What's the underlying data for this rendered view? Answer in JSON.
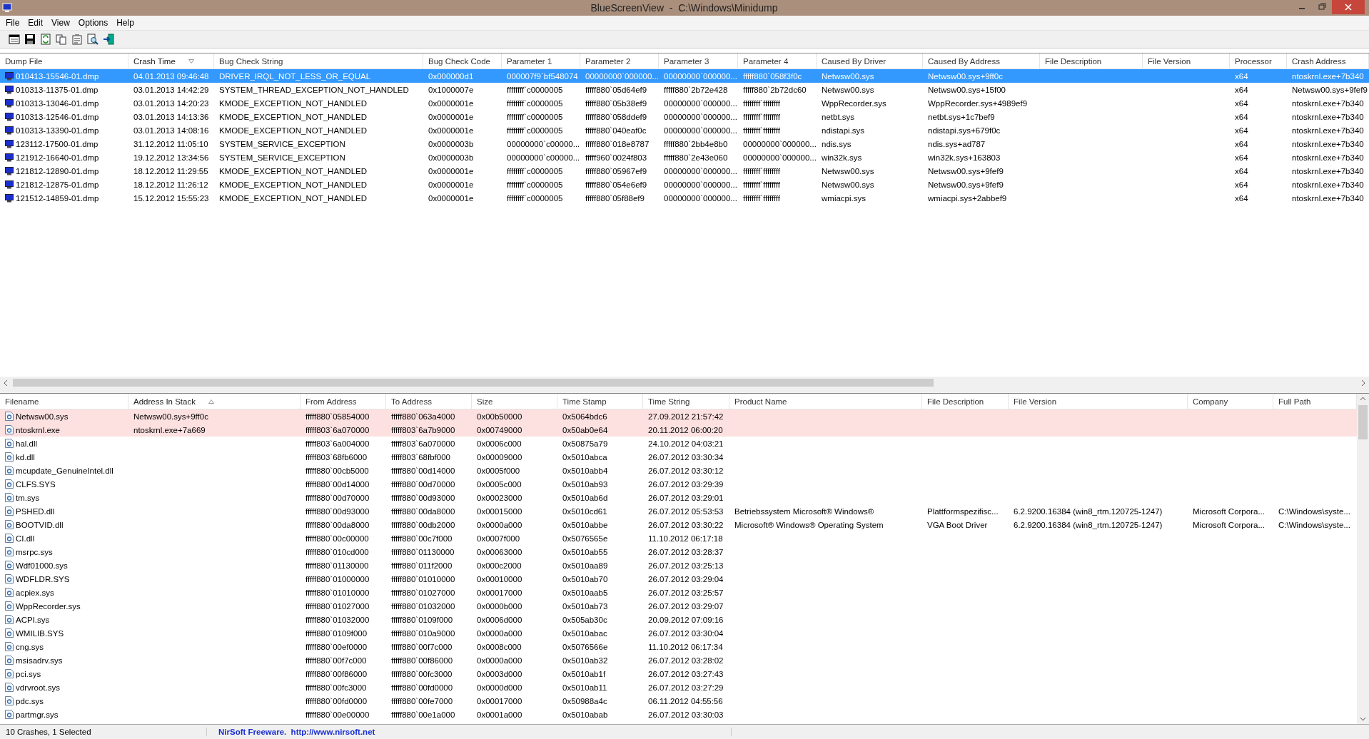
{
  "window": {
    "title": "BlueScreenView  -  C:\\Windows\\Minidump"
  },
  "menu": [
    "File",
    "Edit",
    "View",
    "Options",
    "Help"
  ],
  "crashes": {
    "columns": [
      {
        "label": "Dump File",
        "sorted": false
      },
      {
        "label": "Crash Time",
        "sorted": true,
        "descending": true
      },
      {
        "label": "Bug Check String",
        "sorted": false
      },
      {
        "label": "Bug Check Code",
        "sorted": false
      },
      {
        "label": "Parameter 1",
        "sorted": false
      },
      {
        "label": "Parameter 2",
        "sorted": false
      },
      {
        "label": "Parameter 3",
        "sorted": false
      },
      {
        "label": "Parameter 4",
        "sorted": false
      },
      {
        "label": "Caused By Driver",
        "sorted": false
      },
      {
        "label": "Caused By Address",
        "sorted": false
      },
      {
        "label": "File Description",
        "sorted": false
      },
      {
        "label": "File Version",
        "sorted": false
      },
      {
        "label": "Processor",
        "sorted": false
      },
      {
        "label": "Crash Address",
        "sorted": false
      }
    ],
    "rows": [
      {
        "selected": true,
        "cells": [
          "010413-15546-01.dmp",
          "04.01.2013 09:46:48",
          "DRIVER_IRQL_NOT_LESS_OR_EQUAL",
          "0x000000d1",
          "000007f9`bf548074",
          "00000000`000000...",
          "00000000`000000...",
          "fffff880`058f3f0c",
          "Netwsw00.sys",
          "Netwsw00.sys+9ff0c",
          "",
          "",
          "x64",
          "ntoskrnl.exe+7b340"
        ]
      },
      {
        "selected": false,
        "cells": [
          "010313-11375-01.dmp",
          "03.01.2013 14:42:29",
          "SYSTEM_THREAD_EXCEPTION_NOT_HANDLED",
          "0x1000007e",
          "ffffffff`c0000005",
          "fffff880`05d64ef9",
          "fffff880`2b72e428",
          "fffff880`2b72dc60",
          "Netwsw00.sys",
          "Netwsw00.sys+15f00",
          "",
          "",
          "x64",
          "Netwsw00.sys+9fef9"
        ]
      },
      {
        "selected": false,
        "cells": [
          "010313-13046-01.dmp",
          "03.01.2013 14:20:23",
          "KMODE_EXCEPTION_NOT_HANDLED",
          "0x0000001e",
          "ffffffff`c0000005",
          "fffff880`05b38ef9",
          "00000000`000000...",
          "ffffffff`ffffffff",
          "WppRecorder.sys",
          "WppRecorder.sys+4989ef9",
          "",
          "",
          "x64",
          "ntoskrnl.exe+7b340"
        ]
      },
      {
        "selected": false,
        "cells": [
          "010313-12546-01.dmp",
          "03.01.2013 14:13:36",
          "KMODE_EXCEPTION_NOT_HANDLED",
          "0x0000001e",
          "ffffffff`c0000005",
          "fffff880`058ddef9",
          "00000000`000000...",
          "ffffffff`ffffffff",
          "netbt.sys",
          "netbt.sys+1c7bef9",
          "",
          "",
          "x64",
          "ntoskrnl.exe+7b340"
        ]
      },
      {
        "selected": false,
        "cells": [
          "010313-13390-01.dmp",
          "03.01.2013 14:08:16",
          "KMODE_EXCEPTION_NOT_HANDLED",
          "0x0000001e",
          "ffffffff`c0000005",
          "fffff880`040eaf0c",
          "00000000`000000...",
          "ffffffff`ffffffff",
          "ndistapi.sys",
          "ndistapi.sys+679f0c",
          "",
          "",
          "x64",
          "ntoskrnl.exe+7b340"
        ]
      },
      {
        "selected": false,
        "cells": [
          "123112-17500-01.dmp",
          "31.12.2012 11:05:10",
          "SYSTEM_SERVICE_EXCEPTION",
          "0x0000003b",
          "00000000`c00000...",
          "fffff880`018e8787",
          "fffff880`2bb4e8b0",
          "00000000`000000...",
          "ndis.sys",
          "ndis.sys+ad787",
          "",
          "",
          "x64",
          "ntoskrnl.exe+7b340"
        ]
      },
      {
        "selected": false,
        "cells": [
          "121912-16640-01.dmp",
          "19.12.2012 13:34:56",
          "SYSTEM_SERVICE_EXCEPTION",
          "0x0000003b",
          "00000000`c00000...",
          "fffff960`0024f803",
          "fffff880`2e43e060",
          "00000000`000000...",
          "win32k.sys",
          "win32k.sys+163803",
          "",
          "",
          "x64",
          "ntoskrnl.exe+7b340"
        ]
      },
      {
        "selected": false,
        "cells": [
          "121812-12890-01.dmp",
          "18.12.2012 11:29:55",
          "KMODE_EXCEPTION_NOT_HANDLED",
          "0x0000001e",
          "ffffffff`c0000005",
          "fffff880`05967ef9",
          "00000000`000000...",
          "ffffffff`ffffffff",
          "Netwsw00.sys",
          "Netwsw00.sys+9fef9",
          "",
          "",
          "x64",
          "ntoskrnl.exe+7b340"
        ]
      },
      {
        "selected": false,
        "cells": [
          "121812-12875-01.dmp",
          "18.12.2012 11:26:12",
          "KMODE_EXCEPTION_NOT_HANDLED",
          "0x0000001e",
          "ffffffff`c0000005",
          "fffff880`054e6ef9",
          "00000000`000000...",
          "ffffffff`ffffffff",
          "Netwsw00.sys",
          "Netwsw00.sys+9fef9",
          "",
          "",
          "x64",
          "ntoskrnl.exe+7b340"
        ]
      },
      {
        "selected": false,
        "cells": [
          "121512-14859-01.dmp",
          "15.12.2012 15:55:23",
          "KMODE_EXCEPTION_NOT_HANDLED",
          "0x0000001e",
          "ffffffff`c0000005",
          "fffff880`05f88ef9",
          "00000000`000000...",
          "ffffffff`ffffffff",
          "wmiacpi.sys",
          "wmiacpi.sys+2abbef9",
          "",
          "",
          "x64",
          "ntoskrnl.exe+7b340"
        ]
      }
    ]
  },
  "drivers": {
    "columns": [
      {
        "label": "Filename",
        "sorted": false
      },
      {
        "label": "Address In Stack",
        "sorted": true,
        "descending": false
      },
      {
        "label": "From Address",
        "sorted": false
      },
      {
        "label": "To Address",
        "sorted": false
      },
      {
        "label": "Size",
        "sorted": false
      },
      {
        "label": "Time Stamp",
        "sorted": false
      },
      {
        "label": "Time String",
        "sorted": false
      },
      {
        "label": "Product Name",
        "sorted": false
      },
      {
        "label": "File Description",
        "sorted": false
      },
      {
        "label": "File Version",
        "sorted": false
      },
      {
        "label": "Company",
        "sorted": false
      },
      {
        "label": "Full Path",
        "sorted": false
      }
    ],
    "rows": [
      {
        "highlighted": true,
        "cells": [
          "Netwsw00.sys",
          "Netwsw00.sys+9ff0c",
          "fffff880`05854000",
          "fffff880`063a4000",
          "0x00b50000",
          "0x5064bdc6",
          "27.09.2012 21:57:42",
          "",
          "",
          "",
          "",
          ""
        ]
      },
      {
        "highlighted": true,
        "cells": [
          "ntoskrnl.exe",
          "ntoskrnl.exe+7a669",
          "fffff803`6a070000",
          "fffff803`6a7b9000",
          "0x00749000",
          "0x50ab0e64",
          "20.11.2012 06:00:20",
          "",
          "",
          "",
          "",
          ""
        ]
      },
      {
        "highlighted": false,
        "cells": [
          "hal.dll",
          "",
          "fffff803`6a004000",
          "fffff803`6a070000",
          "0x0006c000",
          "0x50875a79",
          "24.10.2012 04:03:21",
          "",
          "",
          "",
          "",
          ""
        ]
      },
      {
        "highlighted": false,
        "cells": [
          "kd.dll",
          "",
          "fffff803`68fb6000",
          "fffff803`68fbf000",
          "0x00009000",
          "0x5010abca",
          "26.07.2012 03:30:34",
          "",
          "",
          "",
          "",
          ""
        ]
      },
      {
        "highlighted": false,
        "cells": [
          "mcupdate_GenuineIntel.dll",
          "",
          "fffff880`00cb5000",
          "fffff880`00d14000",
          "0x0005f000",
          "0x5010abb4",
          "26.07.2012 03:30:12",
          "",
          "",
          "",
          "",
          ""
        ]
      },
      {
        "highlighted": false,
        "cells": [
          "CLFS.SYS",
          "",
          "fffff880`00d14000",
          "fffff880`00d70000",
          "0x0005c000",
          "0x5010ab93",
          "26.07.2012 03:29:39",
          "",
          "",
          "",
          "",
          ""
        ]
      },
      {
        "highlighted": false,
        "cells": [
          "tm.sys",
          "",
          "fffff880`00d70000",
          "fffff880`00d93000",
          "0x00023000",
          "0x5010ab6d",
          "26.07.2012 03:29:01",
          "",
          "",
          "",
          "",
          ""
        ]
      },
      {
        "highlighted": false,
        "cells": [
          "PSHED.dll",
          "",
          "fffff880`00d93000",
          "fffff880`00da8000",
          "0x00015000",
          "0x5010cd61",
          "26.07.2012 05:53:53",
          "Betriebssystem Microsoft® Windows®",
          "Plattformspezifisc...",
          "6.2.9200.16384 (win8_rtm.120725-1247)",
          "Microsoft Corpora...",
          "C:\\Windows\\syste..."
        ]
      },
      {
        "highlighted": false,
        "cells": [
          "BOOTVID.dll",
          "",
          "fffff880`00da8000",
          "fffff880`00db2000",
          "0x0000a000",
          "0x5010abbe",
          "26.07.2012 03:30:22",
          "Microsoft® Windows® Operating System",
          "VGA Boot Driver",
          "6.2.9200.16384 (win8_rtm.120725-1247)",
          "Microsoft Corpora...",
          "C:\\Windows\\syste..."
        ]
      },
      {
        "highlighted": false,
        "cells": [
          "CI.dll",
          "",
          "fffff880`00c00000",
          "fffff880`00c7f000",
          "0x0007f000",
          "0x5076565e",
          "11.10.2012 06:17:18",
          "",
          "",
          "",
          "",
          ""
        ]
      },
      {
        "highlighted": false,
        "cells": [
          "msrpc.sys",
          "",
          "fffff880`010cd000",
          "fffff880`01130000",
          "0x00063000",
          "0x5010ab55",
          "26.07.2012 03:28:37",
          "",
          "",
          "",
          "",
          ""
        ]
      },
      {
        "highlighted": false,
        "cells": [
          "Wdf01000.sys",
          "",
          "fffff880`01130000",
          "fffff880`011f2000",
          "0x000c2000",
          "0x5010aa89",
          "26.07.2012 03:25:13",
          "",
          "",
          "",
          "",
          ""
        ]
      },
      {
        "highlighted": false,
        "cells": [
          "WDFLDR.SYS",
          "",
          "fffff880`01000000",
          "fffff880`01010000",
          "0x00010000",
          "0x5010ab70",
          "26.07.2012 03:29:04",
          "",
          "",
          "",
          "",
          ""
        ]
      },
      {
        "highlighted": false,
        "cells": [
          "acpiex.sys",
          "",
          "fffff880`01010000",
          "fffff880`01027000",
          "0x00017000",
          "0x5010aab5",
          "26.07.2012 03:25:57",
          "",
          "",
          "",
          "",
          ""
        ]
      },
      {
        "highlighted": false,
        "cells": [
          "WppRecorder.sys",
          "",
          "fffff880`01027000",
          "fffff880`01032000",
          "0x0000b000",
          "0x5010ab73",
          "26.07.2012 03:29:07",
          "",
          "",
          "",
          "",
          ""
        ]
      },
      {
        "highlighted": false,
        "cells": [
          "ACPI.sys",
          "",
          "fffff880`01032000",
          "fffff880`0109f000",
          "0x0006d000",
          "0x505ab30c",
          "20.09.2012 07:09:16",
          "",
          "",
          "",
          "",
          ""
        ]
      },
      {
        "highlighted": false,
        "cells": [
          "WMILIB.SYS",
          "",
          "fffff880`0109f000",
          "fffff880`010a9000",
          "0x0000a000",
          "0x5010abac",
          "26.07.2012 03:30:04",
          "",
          "",
          "",
          "",
          ""
        ]
      },
      {
        "highlighted": false,
        "cells": [
          "cng.sys",
          "",
          "fffff880`00ef0000",
          "fffff880`00f7c000",
          "0x0008c000",
          "0x5076566e",
          "11.10.2012 06:17:34",
          "",
          "",
          "",
          "",
          ""
        ]
      },
      {
        "highlighted": false,
        "cells": [
          "msisadrv.sys",
          "",
          "fffff880`00f7c000",
          "fffff880`00f86000",
          "0x0000a000",
          "0x5010ab32",
          "26.07.2012 03:28:02",
          "",
          "",
          "",
          "",
          ""
        ]
      },
      {
        "highlighted": false,
        "cells": [
          "pci.sys",
          "",
          "fffff880`00f86000",
          "fffff880`00fc3000",
          "0x0003d000",
          "0x5010ab1f",
          "26.07.2012 03:27:43",
          "",
          "",
          "",
          "",
          ""
        ]
      },
      {
        "highlighted": false,
        "cells": [
          "vdrvroot.sys",
          "",
          "fffff880`00fc3000",
          "fffff880`00fd0000",
          "0x0000d000",
          "0x5010ab11",
          "26.07.2012 03:27:29",
          "",
          "",
          "",
          "",
          ""
        ]
      },
      {
        "highlighted": false,
        "cells": [
          "pdc.sys",
          "",
          "fffff880`00fd0000",
          "fffff880`00fe7000",
          "0x00017000",
          "0x50988a4c",
          "06.11.2012 04:55:56",
          "",
          "",
          "",
          "",
          ""
        ]
      },
      {
        "highlighted": false,
        "cells": [
          "partmgr.sys",
          "",
          "fffff880`00e00000",
          "fffff880`00e1a000",
          "0x0001a000",
          "0x5010abab",
          "26.07.2012 03:30:03",
          "",
          "",
          "",
          "",
          ""
        ]
      }
    ]
  },
  "status_bar": {
    "count": "10 Crashes, 1 Selected",
    "link": "NirSoft Freeware.  http://www.nirsoft.net"
  }
}
